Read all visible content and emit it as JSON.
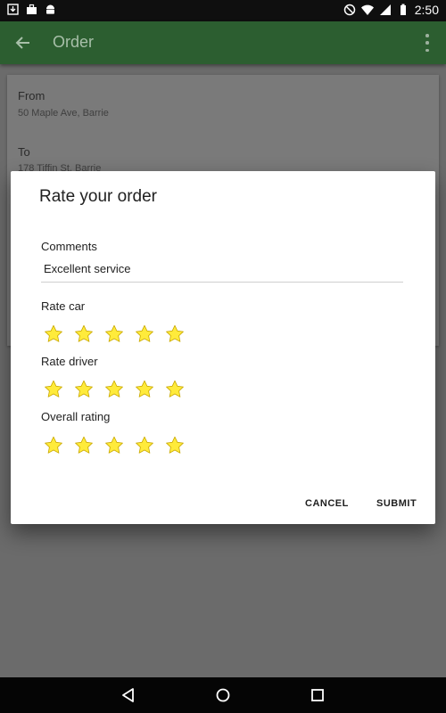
{
  "status_bar": {
    "time": "2:50",
    "left_icons": [
      "download-icon",
      "briefcase-icon",
      "android-icon"
    ],
    "right_icons": [
      "do-not-disturb-icon",
      "wifi-icon",
      "signal-icon",
      "battery-icon"
    ]
  },
  "app_bar": {
    "title": "Order",
    "color": "#43a047"
  },
  "order": {
    "from_label": "From",
    "from_value": "50 Maple Ave, Barrie",
    "to_label": "To",
    "to_value": "178 Tiffin St, Barrie"
  },
  "dialog": {
    "title": "Rate your order",
    "comments_label": "Comments",
    "comments_value": "Excellent service",
    "rate_car_label": "Rate car",
    "rate_car_value": 5,
    "rate_driver_label": "Rate driver",
    "rate_driver_value": 5,
    "overall_label": "Overall rating",
    "overall_value": 5,
    "max_rating": 5,
    "star_color": "#ffeb3b",
    "cancel_label": "CANCEL",
    "submit_label": "SUBMIT"
  }
}
